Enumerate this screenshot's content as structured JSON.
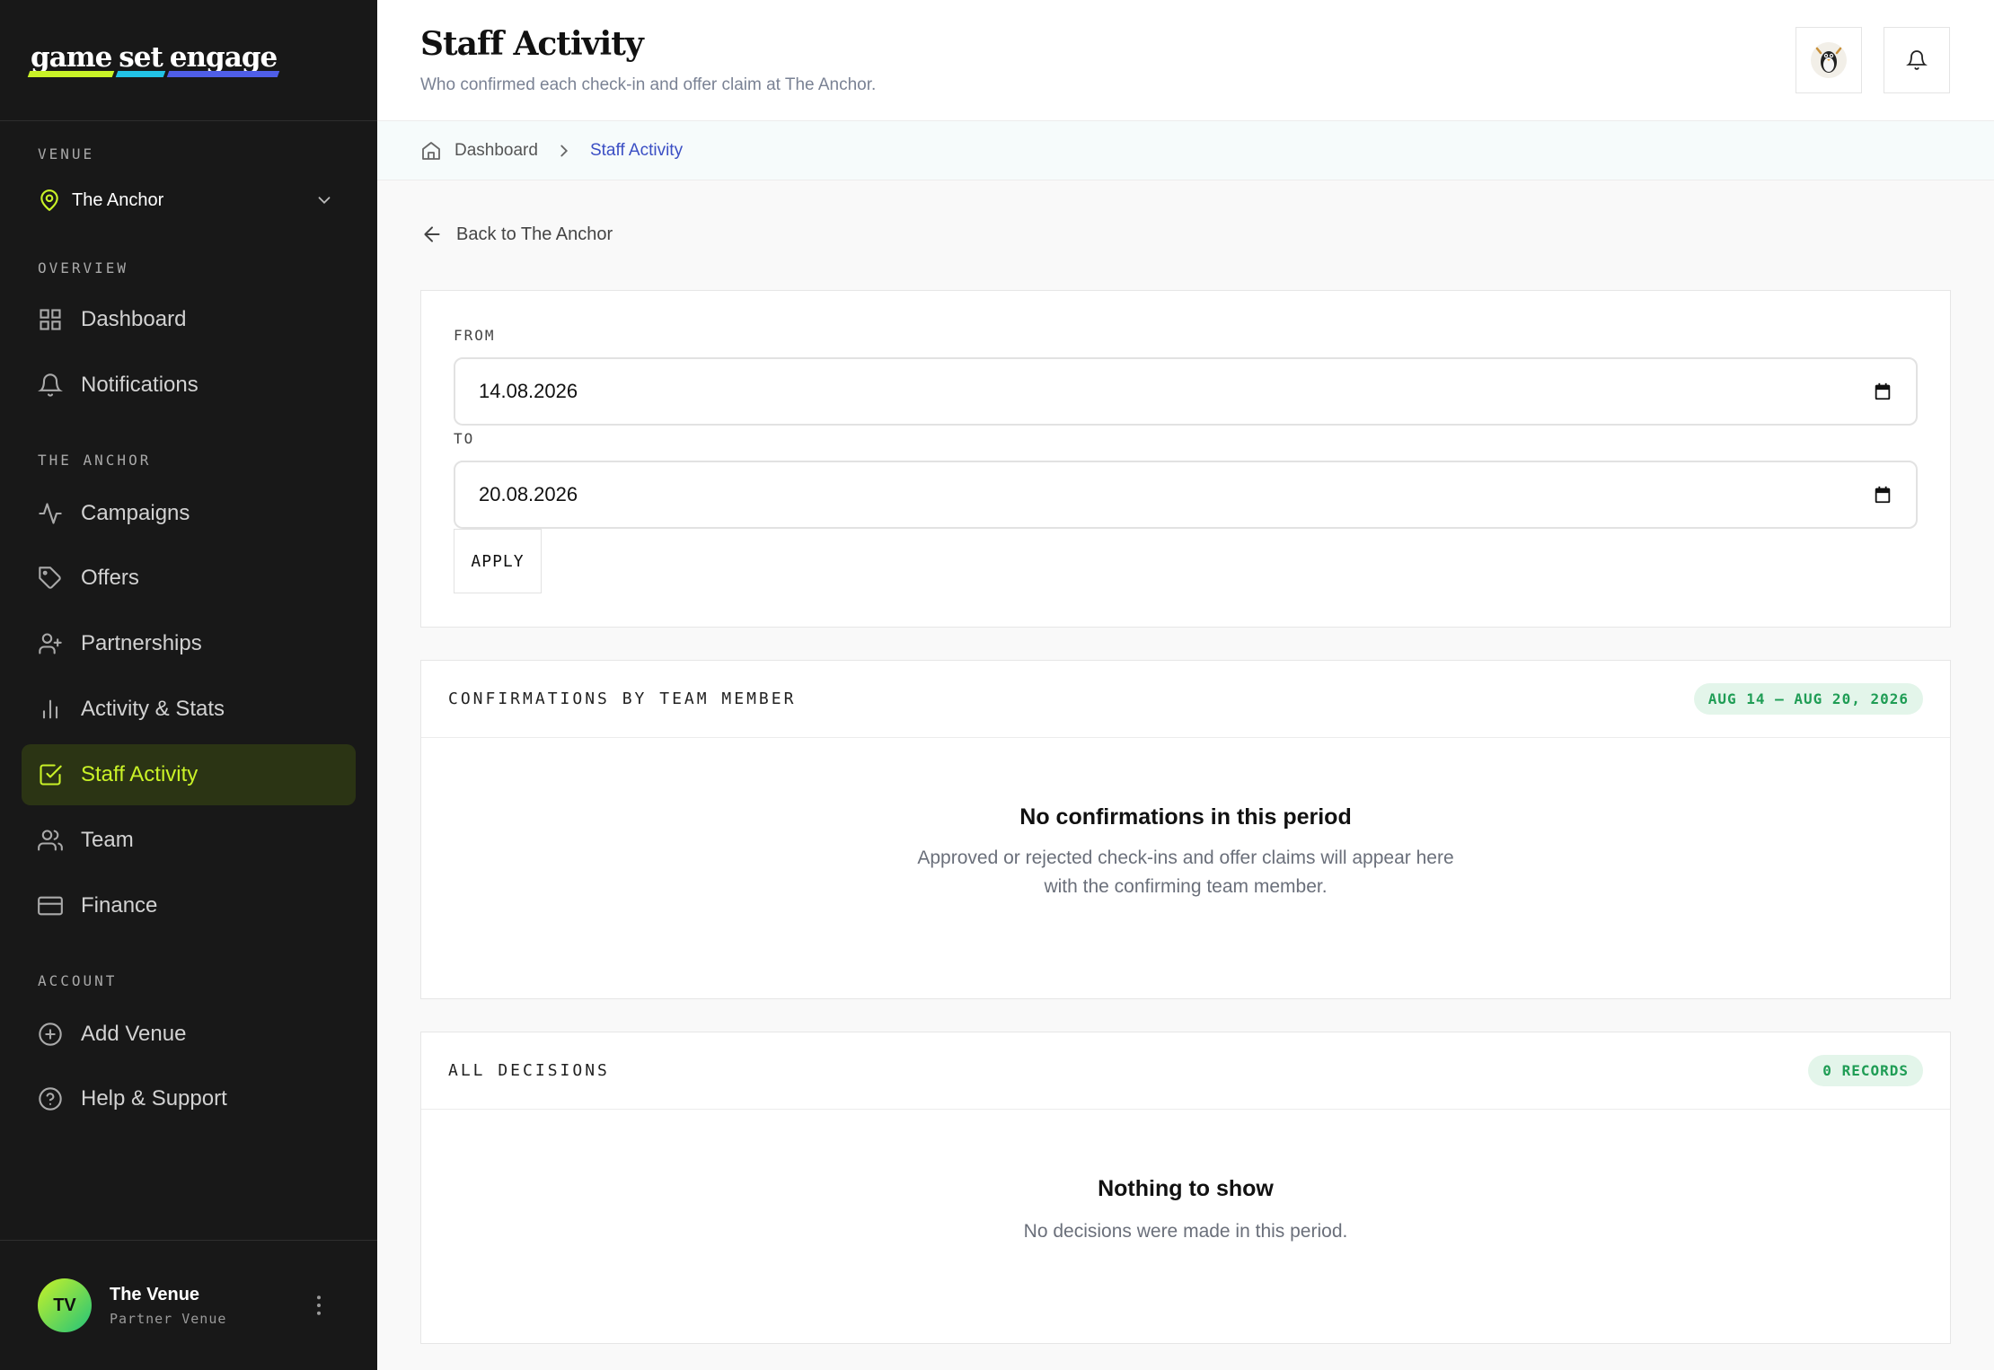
{
  "brand": {
    "words": [
      "game",
      "set",
      "engage"
    ]
  },
  "sidebar": {
    "venue_label": "VENUE",
    "venue_name": "The Anchor",
    "overview_label": "OVERVIEW",
    "overview_items": [
      {
        "label": "Dashboard",
        "icon": "grid-icon"
      },
      {
        "label": "Notifications",
        "icon": "bell-icon"
      }
    ],
    "venue_section_label": "THE ANCHOR",
    "venue_items": [
      {
        "label": "Campaigns",
        "icon": "activity-icon"
      },
      {
        "label": "Offers",
        "icon": "tag-icon"
      },
      {
        "label": "Partnerships",
        "icon": "user-plus-icon"
      },
      {
        "label": "Activity & Stats",
        "icon": "bar-chart-icon"
      },
      {
        "label": "Staff Activity",
        "icon": "check-square-icon",
        "active": true
      },
      {
        "label": "Team",
        "icon": "users-icon"
      },
      {
        "label": "Finance",
        "icon": "credit-card-icon"
      }
    ],
    "account_label": "ACCOUNT",
    "account_items": [
      {
        "label": "Add Venue",
        "icon": "plus-circle-icon"
      },
      {
        "label": "Help & Support",
        "icon": "help-circle-icon"
      }
    ],
    "profile": {
      "initials": "TV",
      "name": "The Venue",
      "role": "Partner Venue"
    }
  },
  "header": {
    "title": "Staff Activity",
    "subtitle": "Who confirmed each check-in and offer claim at The Anchor."
  },
  "breadcrumb": {
    "home": "Dashboard",
    "current": "Staff Activity"
  },
  "back_link": "Back to The Anchor",
  "filters": {
    "from_label": "FROM",
    "from_value": "14.08.2026",
    "to_label": "TO",
    "to_value": "20.08.2026",
    "apply_label": "APPLY"
  },
  "confirmations": {
    "title": "CONFIRMATIONS BY TEAM MEMBER",
    "range_badge": "AUG 14 – AUG 20, 2026",
    "empty_title": "No confirmations in this period",
    "empty_text": "Approved or rejected check-ins and offer claims will appear here with the confirming team member."
  },
  "decisions": {
    "title": "ALL DECISIONS",
    "count_badge": "0 RECORDS",
    "empty_title": "Nothing to show",
    "empty_text": "No decisions were made in this period."
  },
  "colors": {
    "accent": "#c9f227",
    "sidebar_bg": "#181818",
    "link": "#3b4fc4",
    "badge_green": "#1f9d55"
  }
}
